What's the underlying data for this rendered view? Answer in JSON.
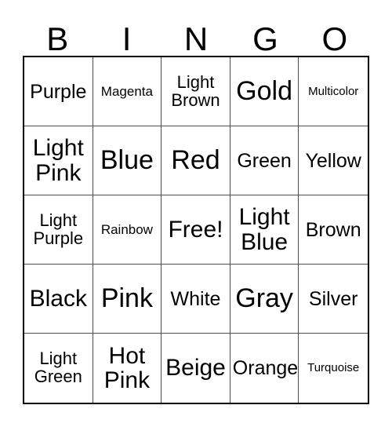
{
  "card": {
    "title": "BINGO",
    "headers": [
      "B",
      "I",
      "N",
      "G",
      "O"
    ],
    "free_space_label": "Free!",
    "colors": {
      "text": "#000000",
      "background": "#ffffff",
      "outer_border": "#000000",
      "inner_border": "#4d4d4d"
    },
    "rows": [
      [
        {
          "label": "Purple",
          "size": "md"
        },
        {
          "label": "Magenta",
          "size": "xs"
        },
        {
          "label": "Light\nBrown",
          "size": "sm"
        },
        {
          "label": "Gold",
          "size": "xl"
        },
        {
          "label": "Multicolor",
          "size": "xxs"
        }
      ],
      [
        {
          "label": "Light\nPink",
          "size": "lg"
        },
        {
          "label": "Blue",
          "size": "xl"
        },
        {
          "label": "Red",
          "size": "xl"
        },
        {
          "label": "Green",
          "size": "md"
        },
        {
          "label": "Yellow",
          "size": "md"
        }
      ],
      [
        {
          "label": "Light\nPurple",
          "size": "sm"
        },
        {
          "label": "Rainbow",
          "size": "xs"
        },
        {
          "label": "Free!",
          "size": "lg"
        },
        {
          "label": "Light\nBlue",
          "size": "lg"
        },
        {
          "label": "Brown",
          "size": "md"
        }
      ],
      [
        {
          "label": "Black",
          "size": "lg"
        },
        {
          "label": "Pink",
          "size": "xl"
        },
        {
          "label": "White",
          "size": "md"
        },
        {
          "label": "Gray",
          "size": "xl"
        },
        {
          "label": "Silver",
          "size": "md"
        }
      ],
      [
        {
          "label": "Light\nGreen",
          "size": "sm"
        },
        {
          "label": "Hot\nPink",
          "size": "lg"
        },
        {
          "label": "Beige",
          "size": "lg"
        },
        {
          "label": "Orange",
          "size": "md"
        },
        {
          "label": "Turquoise",
          "size": "xxs"
        }
      ]
    ]
  }
}
